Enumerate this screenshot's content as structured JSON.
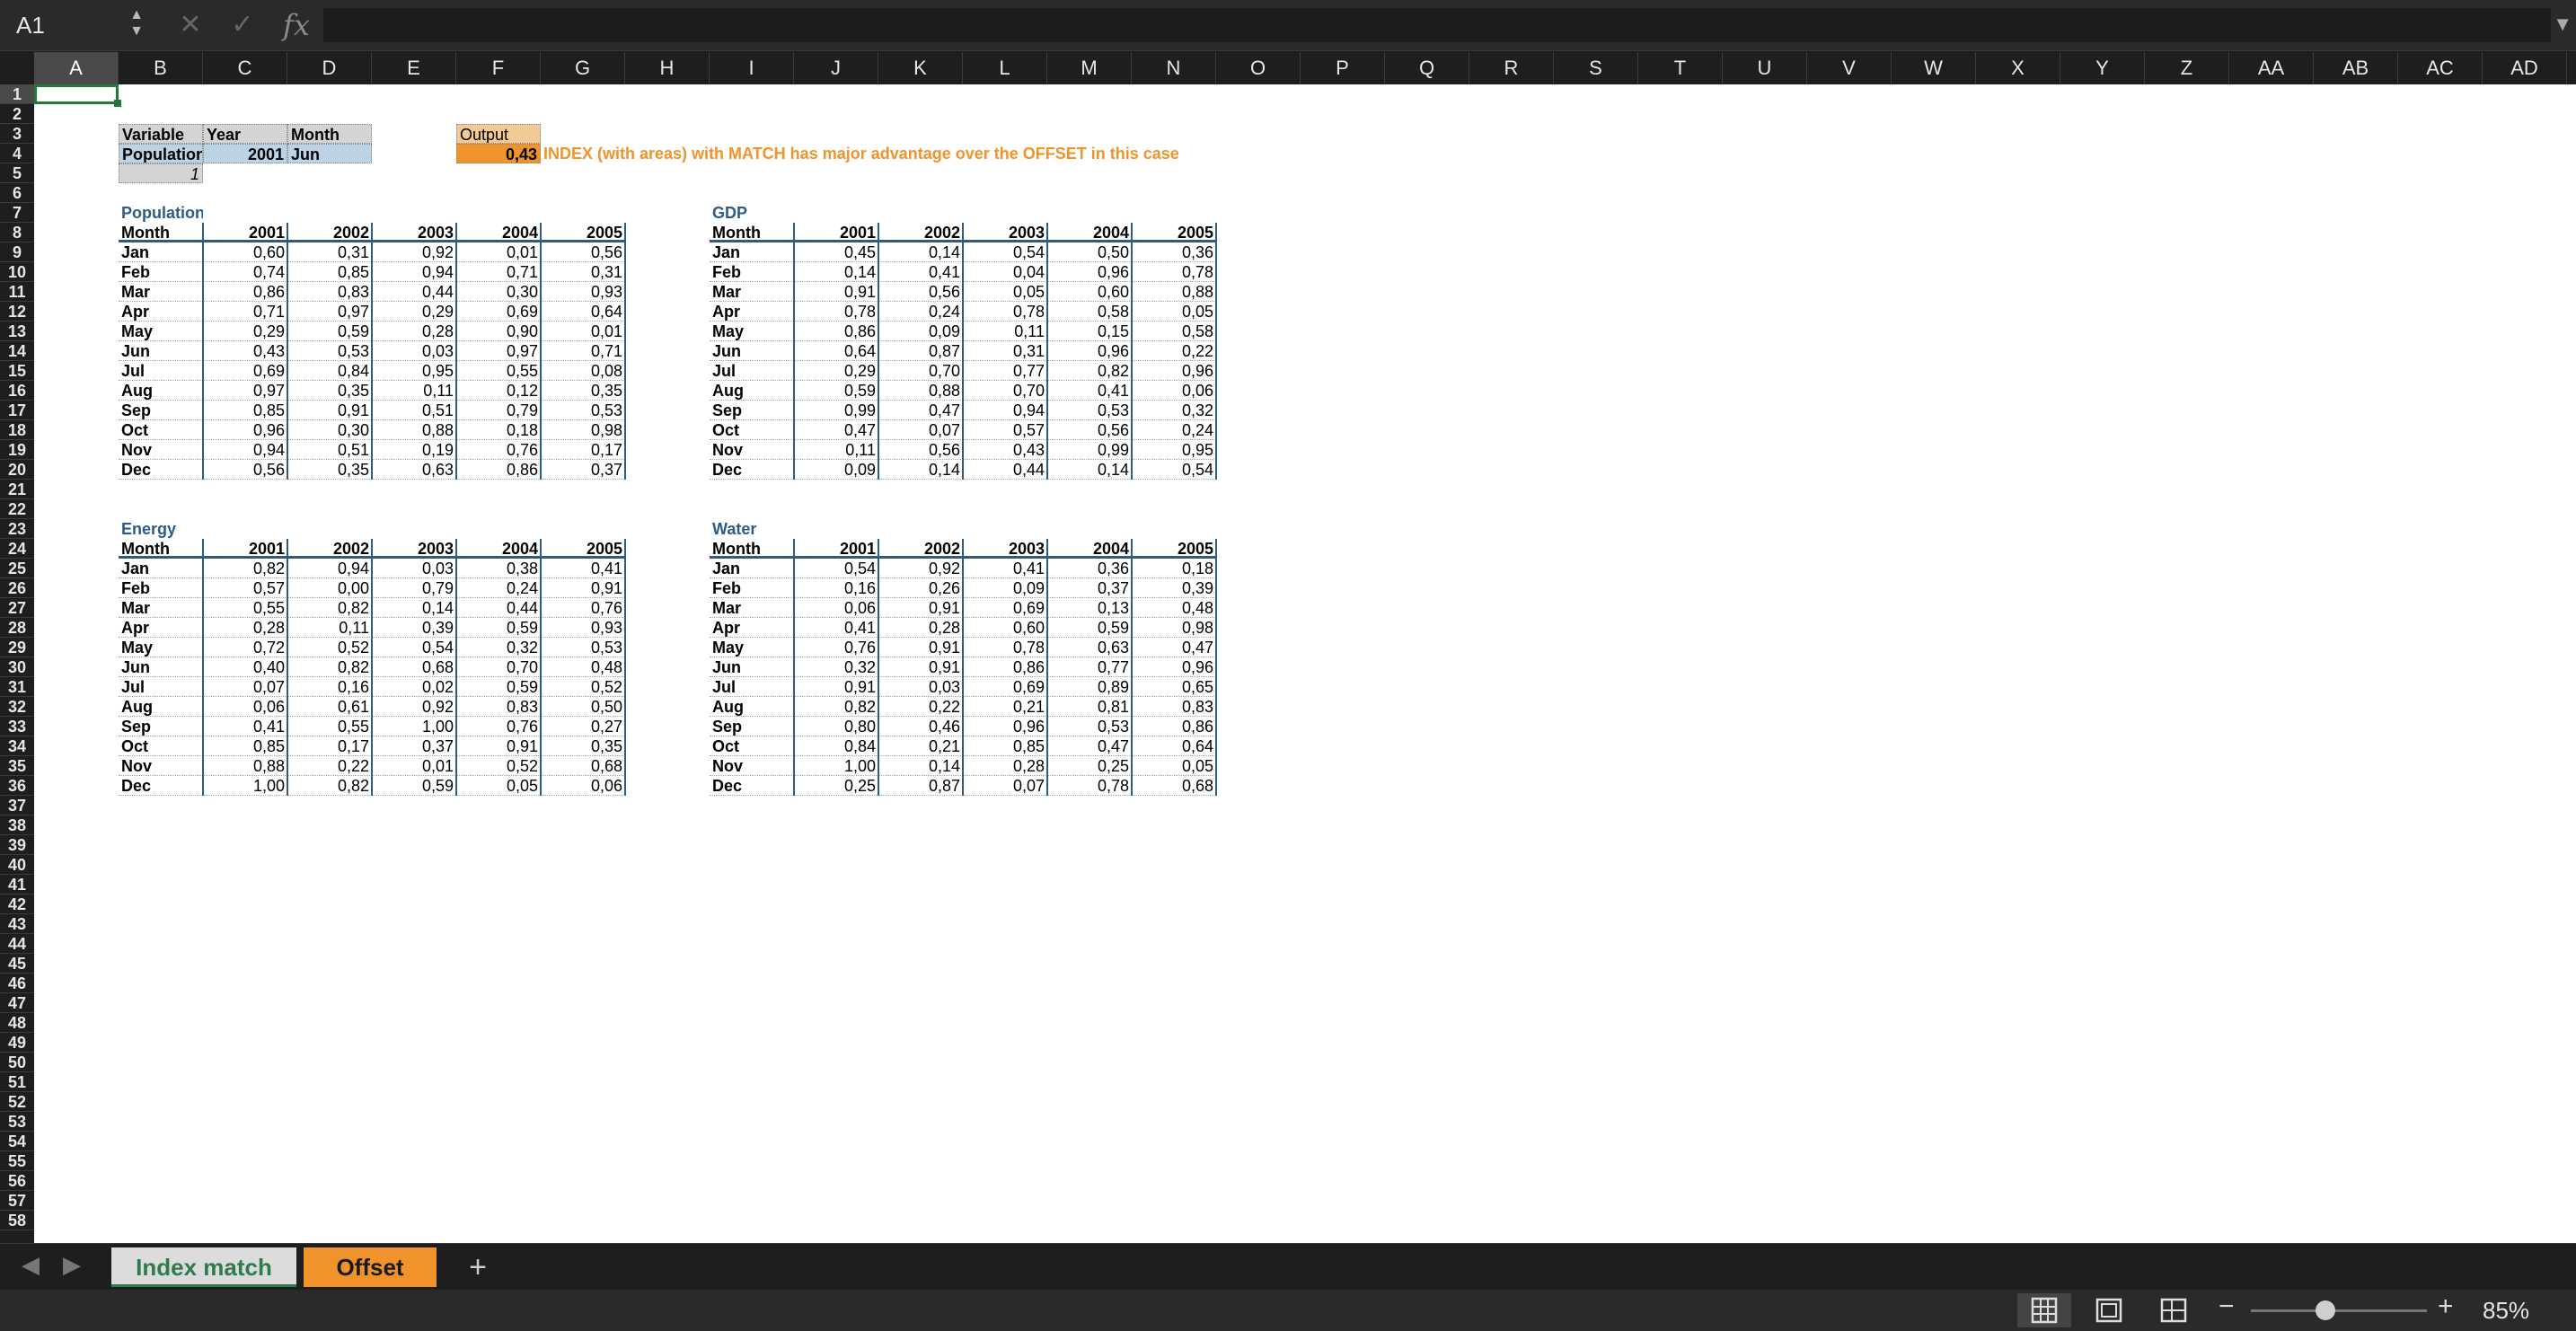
{
  "formula_bar": {
    "name_box": "A1",
    "fx_label": "fx",
    "formula": ""
  },
  "columns": [
    "A",
    "B",
    "C",
    "D",
    "E",
    "F",
    "G",
    "H",
    "I",
    "J",
    "K",
    "L",
    "M",
    "N",
    "O",
    "P",
    "Q",
    "R",
    "S",
    "T",
    "U",
    "V",
    "W",
    "X",
    "Y",
    "Z",
    "AA",
    "AB",
    "AC",
    "AD"
  ],
  "rows": [
    "1",
    "2",
    "3",
    "4",
    "5",
    "6",
    "7",
    "8",
    "9",
    "10",
    "11",
    "12",
    "13",
    "14",
    "15",
    "16",
    "17",
    "18",
    "19",
    "20",
    "21",
    "22",
    "23",
    "24",
    "25",
    "26",
    "27",
    "28",
    "29",
    "30",
    "31",
    "32",
    "33",
    "34",
    "35",
    "36",
    "37",
    "38",
    "39",
    "40",
    "41",
    "42",
    "43",
    "44",
    "45",
    "46",
    "47",
    "48",
    "49",
    "50",
    "51",
    "52",
    "53",
    "54",
    "55",
    "56",
    "57",
    "58"
  ],
  "inputs": {
    "h_variable": "Variable",
    "h_year": "Year",
    "h_month": "Month",
    "variable": "Population",
    "year": "2001",
    "month": "Jun",
    "index": "1",
    "output_label": "Output",
    "output_value": "0,43",
    "note": "INDEX (with areas) with MATCH has major advantage over the OFFSET in this case"
  },
  "tables": [
    {
      "title": "Population",
      "header_month": "Month",
      "years": [
        "2001",
        "2002",
        "2003",
        "2004",
        "2005"
      ],
      "months": [
        "Jan",
        "Feb",
        "Mar",
        "Apr",
        "May",
        "Jun",
        "Jul",
        "Aug",
        "Sep",
        "Oct",
        "Nov",
        "Dec"
      ],
      "values": [
        [
          "0,60",
          "0,31",
          "0,92",
          "0,01",
          "0,56"
        ],
        [
          "0,74",
          "0,85",
          "0,94",
          "0,71",
          "0,31"
        ],
        [
          "0,86",
          "0,83",
          "0,44",
          "0,30",
          "0,93"
        ],
        [
          "0,71",
          "0,97",
          "0,29",
          "0,69",
          "0,64"
        ],
        [
          "0,29",
          "0,59",
          "0,28",
          "0,90",
          "0,01"
        ],
        [
          "0,43",
          "0,53",
          "0,03",
          "0,97",
          "0,71"
        ],
        [
          "0,69",
          "0,84",
          "0,95",
          "0,55",
          "0,08"
        ],
        [
          "0,97",
          "0,35",
          "0,11",
          "0,12",
          "0,35"
        ],
        [
          "0,85",
          "0,91",
          "0,51",
          "0,79",
          "0,53"
        ],
        [
          "0,96",
          "0,30",
          "0,88",
          "0,18",
          "0,98"
        ],
        [
          "0,94",
          "0,51",
          "0,19",
          "0,76",
          "0,17"
        ],
        [
          "0,56",
          "0,35",
          "0,63",
          "0,86",
          "0,37"
        ]
      ]
    },
    {
      "title": "GDP",
      "header_month": "Month",
      "years": [
        "2001",
        "2002",
        "2003",
        "2004",
        "2005"
      ],
      "months": [
        "Jan",
        "Feb",
        "Mar",
        "Apr",
        "May",
        "Jun",
        "Jul",
        "Aug",
        "Sep",
        "Oct",
        "Nov",
        "Dec"
      ],
      "values": [
        [
          "0,45",
          "0,14",
          "0,54",
          "0,50",
          "0,36"
        ],
        [
          "0,14",
          "0,41",
          "0,04",
          "0,96",
          "0,78"
        ],
        [
          "0,91",
          "0,56",
          "0,05",
          "0,60",
          "0,88"
        ],
        [
          "0,78",
          "0,24",
          "0,78",
          "0,58",
          "0,05"
        ],
        [
          "0,86",
          "0,09",
          "0,11",
          "0,15",
          "0,58"
        ],
        [
          "0,64",
          "0,87",
          "0,31",
          "0,96",
          "0,22"
        ],
        [
          "0,29",
          "0,70",
          "0,77",
          "0,82",
          "0,96"
        ],
        [
          "0,59",
          "0,88",
          "0,70",
          "0,41",
          "0,06"
        ],
        [
          "0,99",
          "0,47",
          "0,94",
          "0,53",
          "0,32"
        ],
        [
          "0,47",
          "0,07",
          "0,57",
          "0,56",
          "0,24"
        ],
        [
          "0,11",
          "0,56",
          "0,43",
          "0,99",
          "0,95"
        ],
        [
          "0,09",
          "0,14",
          "0,44",
          "0,14",
          "0,54"
        ]
      ]
    },
    {
      "title": "Energy",
      "header_month": "Month",
      "years": [
        "2001",
        "2002",
        "2003",
        "2004",
        "2005"
      ],
      "months": [
        "Jan",
        "Feb",
        "Mar",
        "Apr",
        "May",
        "Jun",
        "Jul",
        "Aug",
        "Sep",
        "Oct",
        "Nov",
        "Dec"
      ],
      "values": [
        [
          "0,82",
          "0,94",
          "0,03",
          "0,38",
          "0,41"
        ],
        [
          "0,57",
          "0,00",
          "0,79",
          "0,24",
          "0,91"
        ],
        [
          "0,55",
          "0,82",
          "0,14",
          "0,44",
          "0,76"
        ],
        [
          "0,28",
          "0,11",
          "0,39",
          "0,59",
          "0,93"
        ],
        [
          "0,72",
          "0,52",
          "0,54",
          "0,32",
          "0,53"
        ],
        [
          "0,40",
          "0,82",
          "0,68",
          "0,70",
          "0,48"
        ],
        [
          "0,07",
          "0,16",
          "0,02",
          "0,59",
          "0,52"
        ],
        [
          "0,06",
          "0,61",
          "0,92",
          "0,83",
          "0,50"
        ],
        [
          "0,41",
          "0,55",
          "1,00",
          "0,76",
          "0,27"
        ],
        [
          "0,85",
          "0,17",
          "0,37",
          "0,91",
          "0,35"
        ],
        [
          "0,88",
          "0,22",
          "0,01",
          "0,52",
          "0,68"
        ],
        [
          "1,00",
          "0,82",
          "0,59",
          "0,05",
          "0,06"
        ]
      ]
    },
    {
      "title": "Water",
      "header_month": "Month",
      "years": [
        "2001",
        "2002",
        "2003",
        "2004",
        "2005"
      ],
      "months": [
        "Jan",
        "Feb",
        "Mar",
        "Apr",
        "May",
        "Jun",
        "Jul",
        "Aug",
        "Sep",
        "Oct",
        "Nov",
        "Dec"
      ],
      "values": [
        [
          "0,54",
          "0,92",
          "0,41",
          "0,36",
          "0,18"
        ],
        [
          "0,16",
          "0,26",
          "0,09",
          "0,37",
          "0,39"
        ],
        [
          "0,06",
          "0,91",
          "0,69",
          "0,13",
          "0,48"
        ],
        [
          "0,41",
          "0,28",
          "0,60",
          "0,59",
          "0,98"
        ],
        [
          "0,76",
          "0,91",
          "0,78",
          "0,63",
          "0,47"
        ],
        [
          "0,32",
          "0,91",
          "0,86",
          "0,77",
          "0,96"
        ],
        [
          "0,91",
          "0,03",
          "0,69",
          "0,89",
          "0,65"
        ],
        [
          "0,82",
          "0,22",
          "0,21",
          "0,81",
          "0,83"
        ],
        [
          "0,80",
          "0,46",
          "0,96",
          "0,53",
          "0,86"
        ],
        [
          "0,84",
          "0,21",
          "0,85",
          "0,47",
          "0,64"
        ],
        [
          "1,00",
          "0,14",
          "0,28",
          "0,25",
          "0,05"
        ],
        [
          "0,25",
          "0,87",
          "0,07",
          "0,78",
          "0,68"
        ]
      ]
    }
  ],
  "tabs": [
    {
      "label": "Index match",
      "active": true
    },
    {
      "label": "Offset",
      "active": false
    }
  ],
  "add_sheet_label": "+",
  "status": {
    "zoom_label": "85%",
    "zoom_level": 0.85
  },
  "colors": {
    "accent_green": "#1f7a3a",
    "orange": "#f0932b",
    "table_blue": "#2e5b84"
  }
}
